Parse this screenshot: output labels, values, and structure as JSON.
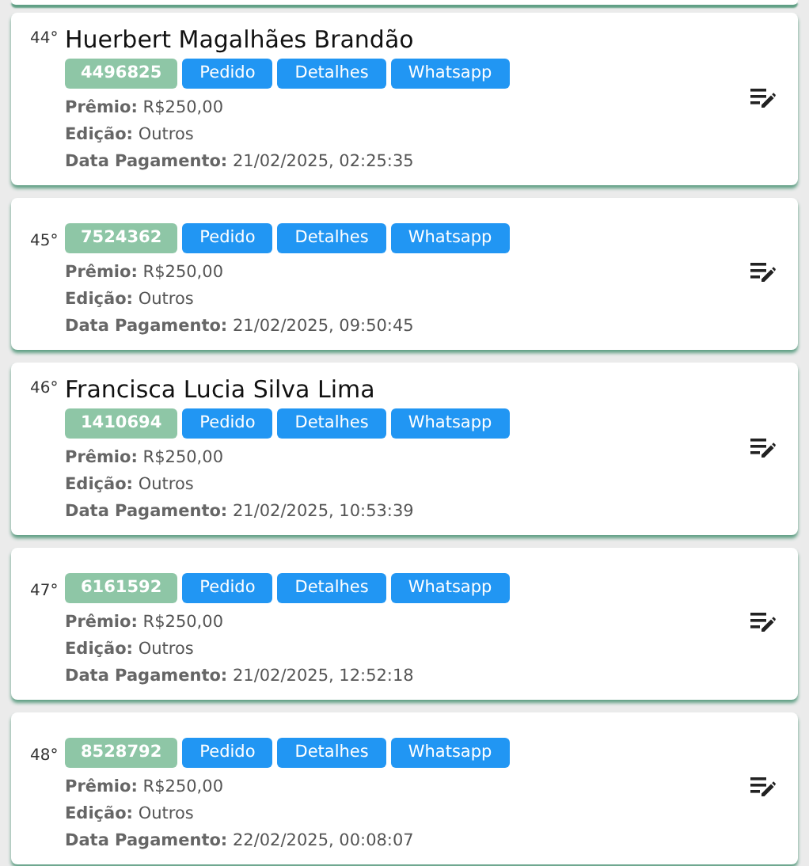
{
  "cards": [
    {
      "rank": "44°",
      "name": "Huerbert Magalhães Brandão",
      "id": "4496825",
      "buttons": [
        "Pedido",
        "Detalhes",
        "Whatsapp"
      ],
      "fields": [
        {
          "label": "Prêmio:",
          "value": "R$250,00"
        },
        {
          "label": "Edição:",
          "value": "Outros"
        },
        {
          "label": "Data Pagamento:",
          "value": "21/02/2025, 02:25:35"
        }
      ]
    },
    {
      "rank": "45°",
      "id": "7524362",
      "buttons": [
        "Pedido",
        "Detalhes",
        "Whatsapp"
      ],
      "fields": [
        {
          "label": "Prêmio:",
          "value": "R$250,00"
        },
        {
          "label": "Edição:",
          "value": "Outros"
        },
        {
          "label": "Data Pagamento:",
          "value": "21/02/2025, 09:50:45"
        }
      ]
    },
    {
      "rank": "46°",
      "name": "Francisca Lucia Silva Lima",
      "id": "1410694",
      "buttons": [
        "Pedido",
        "Detalhes",
        "Whatsapp"
      ],
      "fields": [
        {
          "label": "Prêmio:",
          "value": "R$250,00"
        },
        {
          "label": "Edição:",
          "value": "Outros"
        },
        {
          "label": "Data Pagamento:",
          "value": "21/02/2025, 10:53:39"
        }
      ]
    },
    {
      "rank": "47°",
      "id": "6161592",
      "buttons": [
        "Pedido",
        "Detalhes",
        "Whatsapp"
      ],
      "fields": [
        {
          "label": "Prêmio:",
          "value": "R$250,00"
        },
        {
          "label": "Edição:",
          "value": "Outros"
        },
        {
          "label": "Data Pagamento:",
          "value": "21/02/2025, 12:52:18"
        }
      ]
    },
    {
      "rank": "48°",
      "id": "8528792",
      "buttons": [
        "Pedido",
        "Detalhes",
        "Whatsapp"
      ],
      "fields": [
        {
          "label": "Prêmio:",
          "value": "R$250,00"
        },
        {
          "label": "Edição:",
          "value": "Outros"
        },
        {
          "label": "Data Pagamento:",
          "value": "22/02/2025, 00:08:07"
        }
      ]
    }
  ]
}
